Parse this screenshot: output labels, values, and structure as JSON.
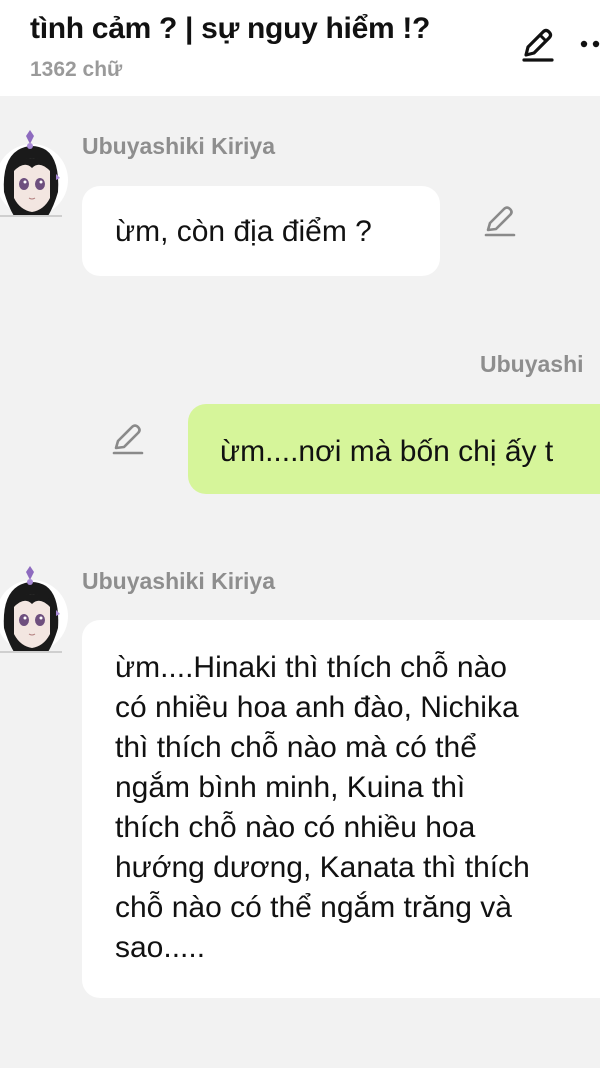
{
  "header": {
    "title": "tình cảm ? | sự nguy hiểm !?",
    "word_count": "1362 chữ",
    "edit_icon": "pen-icon",
    "more_icon": "more-vertical-icon"
  },
  "messages": [
    {
      "sender": "Ubuyashiki Kiriya",
      "side": "left",
      "text_lines": [
        "ừm, còn địa điểm ?"
      ]
    },
    {
      "sender": "Ubuyashi",
      "side": "right",
      "text_lines": [
        "ừm....nơi mà bốn chị ấy t"
      ]
    },
    {
      "sender": "Ubuyashiki Kiriya",
      "side": "left",
      "text_lines": [
        "ừm....Hinaki thì thích chỗ nào",
        "có nhiều hoa anh đào, Nichika",
        "thì thích chỗ nào mà có thể",
        "ngắm bình minh, Kuina thì",
        "thích chỗ nào có nhiều hoa",
        "hướng dương, Kanata thì thích",
        "chỗ nào có thể ngắm trăng và",
        "sao....."
      ]
    }
  ],
  "colors": {
    "background": "#f2f2f2",
    "bubble_left": "#ffffff",
    "bubble_right": "#d6f59a",
    "sender_text": "#8e8e8e"
  }
}
